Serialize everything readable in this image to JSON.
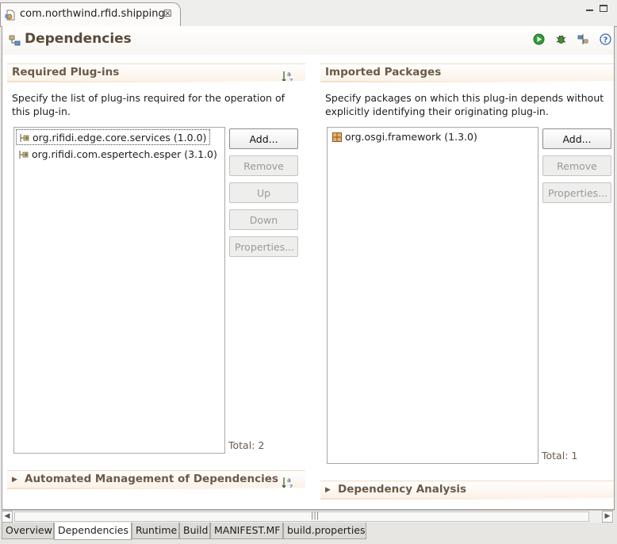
{
  "editor_tab": {
    "title": "com.northwind.rfid.shipping"
  },
  "page": {
    "title": "Dependencies"
  },
  "required_plugins": {
    "title": "Required Plug-ins",
    "description_line1": "Specify the list of plug-ins required for the operation of",
    "description_line2": "this plug-in.",
    "items": [
      {
        "label": "org.rifidi.edge.core.services (1.0.0)"
      },
      {
        "label": "org.rifidi.com.espertech.esper (3.1.0)"
      }
    ],
    "buttons": {
      "add": "Add...",
      "remove": "Remove",
      "up": "Up",
      "down": "Down",
      "properties": "Properties..."
    },
    "total": "Total: 2"
  },
  "imported_packages": {
    "title": "Imported Packages",
    "description_line1": "Specify packages on which this plug-in depends without",
    "description_line2": "explicitly identifying their originating plug-in.",
    "items": [
      {
        "label": "org.osgi.framework (1.3.0)"
      }
    ],
    "buttons": {
      "add": "Add...",
      "remove": "Remove",
      "properties": "Properties..."
    },
    "total": "Total: 1"
  },
  "automated_management": {
    "title": "Automated Management of Dependencies"
  },
  "dependency_analysis": {
    "title": "Dependency Analysis"
  },
  "bottom_tabs": [
    "Overview",
    "Dependencies",
    "Runtime",
    "Build",
    "MANIFEST.MF",
    "build.properties"
  ],
  "colors": {
    "section_title": "#6b5a48",
    "title": "#5a4a39",
    "header_bg": "#fbf2e7"
  }
}
